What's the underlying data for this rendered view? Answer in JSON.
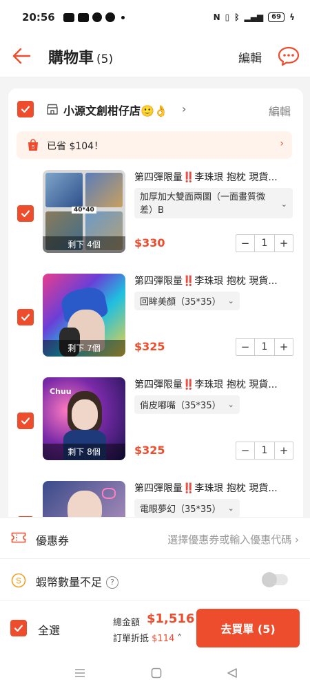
{
  "status_bar": {
    "time": "20:56",
    "battery": "69"
  },
  "header": {
    "title": "購物車",
    "count": "(5)",
    "edit_label": "編輯"
  },
  "shop": {
    "name": "小源文創柑仔店🙂👌",
    "chevron": "›",
    "edit_label": "編輯"
  },
  "promo": {
    "text": "已省 $104！",
    "arrow": "›"
  },
  "items": [
    {
      "name": "第四彈限量‼️李珠珢 抱枕 現貨...",
      "variant": "加厚加大雙面兩圖（一面畫質微差）B",
      "price": "$330",
      "qty": "1",
      "stock": "剩下 4個",
      "thumb_label": "40*40"
    },
    {
      "name": "第四彈限量‼️李珠珢 抱枕 現貨...",
      "variant": "回眸美顏（35*35）",
      "price": "$325",
      "qty": "1",
      "stock": "剩下 7個"
    },
    {
      "name": "第四彈限量‼️李珠珢 抱枕 現貨...",
      "variant": "俏皮嘟嘴（35*35）",
      "price": "$325",
      "qty": "1",
      "stock": "剩下 8個",
      "thumb_label": "Chuu"
    },
    {
      "name": "第四彈限量‼️李珠珢 抱枕 現貨...",
      "variant": "電眼夢幻（35*35）",
      "price": "",
      "qty": "",
      "stock": ""
    }
  ],
  "stepper": {
    "minus": "−",
    "plus": "+"
  },
  "coupon": {
    "label": "優惠券",
    "hint": "選擇優惠券或輸入優惠代碼"
  },
  "coins": {
    "label": "蝦幣數量不足",
    "help": "?"
  },
  "checkout": {
    "select_all": "全選",
    "total_label": "總金額",
    "total_value": "$1,516",
    "discount_label": "訂單折抵",
    "discount_value": "$114",
    "buy_label": "去買單 (5)"
  },
  "colors": {
    "accent": "#ee4d2d"
  },
  "icons": [
    "back-arrow-icon",
    "chat-icon",
    "shop-icon",
    "bag-icon",
    "ticket-icon",
    "coin-icon",
    "menu-icon",
    "home-icon",
    "nav-back-icon"
  ]
}
